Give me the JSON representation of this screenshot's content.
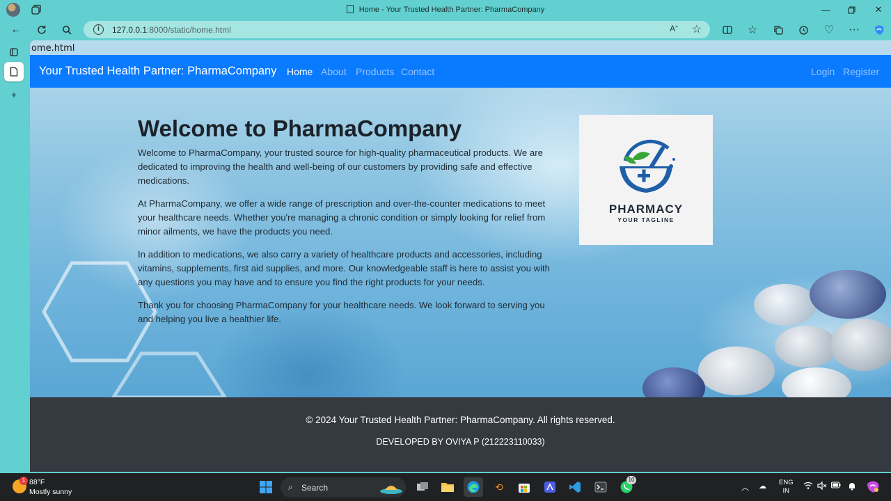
{
  "browser": {
    "window_title": "Home - Your Trusted Health Partner: PharmaCompany",
    "url_host": "127.0.0.1",
    "url_rest": ":8000/static/home.html",
    "file_label": "ome.html"
  },
  "navbar": {
    "brand": "Your Trusted Health Partner: PharmaCompany",
    "links": [
      "Home",
      "About",
      "Products",
      "Contact"
    ],
    "auth": [
      "Login",
      "Register"
    ]
  },
  "hero": {
    "title": "Welcome to PharmaCompany",
    "paragraphs": [
      "Welcome to PharmaCompany, your trusted source for high-quality pharmaceutical products. We are dedicated to improving the health and well-being of our customers by providing safe and effective medications.",
      "At PharmaCompany, we offer a wide range of prescription and over-the-counter medications to meet your healthcare needs. Whether you're managing a chronic condition or simply looking for relief from minor ailments, we have the products you need.",
      "In addition to medications, we also carry a variety of healthcare products and accessories, including vitamins, supplements, first aid supplies, and more. Our knowledgeable staff is here to assist you with any questions you may have and to ensure you find the right products for your needs.",
      "Thank you for choosing PharmaCompany for your healthcare needs. We look forward to serving you and helping you live a healthier life."
    ],
    "logo_name": "PHARMACY",
    "logo_tagline": "YOUR TAGLINE"
  },
  "footer": {
    "copyright": "© 2024 Your Trusted Health Partner: PharmaCompany. All rights reserved.",
    "developer": "DEVELOPED BY OVIYA P (212223110033)"
  },
  "taskbar": {
    "weather_badge": "1",
    "temperature": "88°F",
    "condition": "Mostly sunny",
    "search_label": "Search",
    "whatsapp_badge": "10",
    "lang_top": "ENG",
    "lang_bottom": "IN"
  },
  "colors": {
    "navbar": "#0a7bff",
    "footer": "#343a40",
    "browser_frame": "#62d0d0"
  }
}
